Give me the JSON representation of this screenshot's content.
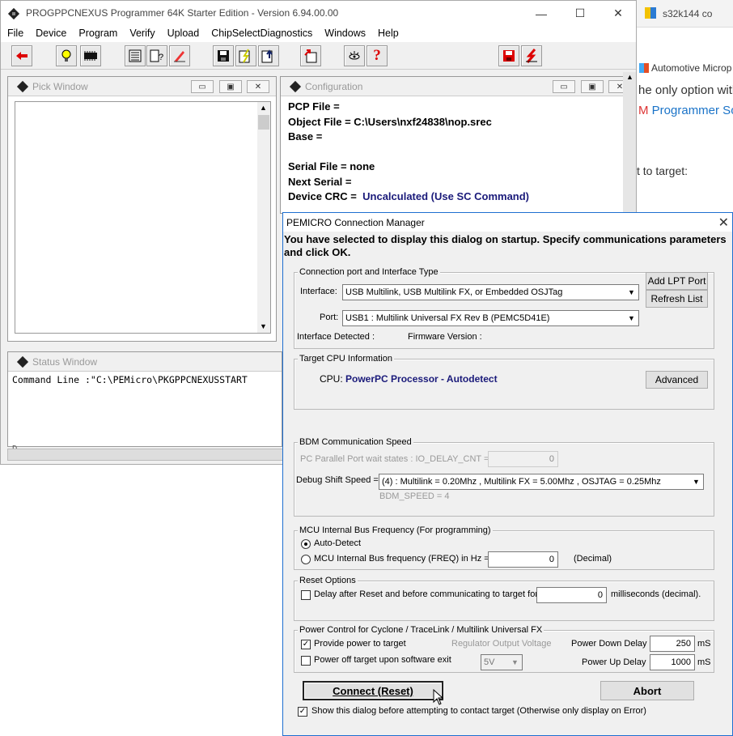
{
  "browser": {
    "tab_title": "s32k144 co",
    "bookmark": "Automotive Microp",
    "line1": "he only option with",
    "line2_red": "M",
    "line2": " Programmer Sof",
    "line3": "t to target:"
  },
  "window": {
    "title": "PROGPPCNEXUS Programmer 64K Starter Edition - Version 6.94.00.00",
    "controls": {
      "minimize": "—",
      "maximize": "☐",
      "close": "✕"
    }
  },
  "menu": [
    "File",
    "Device",
    "Program",
    "Verify",
    "Upload",
    "ChipSelectDiagnostics",
    "Windows",
    "Help"
  ],
  "toolbar_icons": [
    "back-arrow-icon",
    "lightbulb-icon",
    "chip-icon",
    "list-icon",
    "question-doc-icon",
    "pencil-icon",
    "save-icon",
    "lightning-doc-icon",
    "upload-doc-icon",
    "export-icon",
    "eye-icon",
    "help-icon",
    "red-save-icon",
    "red-lightning-icon"
  ],
  "pick_window": {
    "title": "Pick Window"
  },
  "status_window": {
    "title": "Status Window",
    "text": "Command Line :\"C:\\PEMicro\\PKGPPCNEXUSSTART",
    "text2": "D"
  },
  "configuration": {
    "title": "Configuration",
    "lines": [
      {
        "label": "PCP File =",
        "value": ""
      },
      {
        "label": "Object File = C:\\Users\\nxf24838\\nop.srec",
        "value": ""
      },
      {
        "label": "Base =",
        "value": ""
      },
      {
        "label": "",
        "value": ""
      },
      {
        "label": "Serial File = none",
        "value": ""
      },
      {
        "label": "Next Serial  =",
        "value": ""
      },
      {
        "label": "Device CRC =",
        "value": "Uncalculated (Use SC Command)"
      }
    ]
  },
  "dialog": {
    "title": "PEMICRO Connection Manager",
    "close": "✕",
    "intro": "You have selected to display this dialog on startup. Specify communications parameters and click OK.",
    "conn": {
      "legend": "Connection port and Interface Type",
      "interface_label": "Interface:",
      "interface_value": "USB Multilink, USB Multilink FX, or Embedded OSJTag",
      "port_label": "Port:",
      "port_value": "USB1 : Multilink Universal FX Rev B (PEMC5D41E)",
      "detected": "Interface Detected :",
      "firmware": "Firmware Version :",
      "add_lpt": "Add LPT Port",
      "refresh": "Refresh List"
    },
    "cpu": {
      "legend": "Target CPU Information",
      "label": "CPU:",
      "value": "PowerPC Processor - Autodetect",
      "advanced": "Advanced"
    },
    "bdm": {
      "legend": "BDM Communication Speed",
      "io_label": "PC Parallel Port wait states : IO_DELAY_CNT =",
      "io_value": "0",
      "shift_label": "Debug Shift Speed =",
      "shift_value": "(4)  :  Multilink = 0.20Mhz  ,  Multilink FX =  5.00Mhz  ,  OSJTAG = 0.25Mhz",
      "bdm_speed": "BDM_SPEED = 4"
    },
    "mcu": {
      "legend": "MCU Internal Bus Frequency (For programming)",
      "auto": "Auto-Detect",
      "freq": "MCU Internal Bus frequency (FREQ) in Hz =",
      "freq_value": "0",
      "decimal": "(Decimal)"
    },
    "reset": {
      "legend": "Reset Options",
      "delay": "Delay after Reset and before communicating to target for",
      "delay_value": "0",
      "ms": "milliseconds (decimal)."
    },
    "power": {
      "legend": "Power Control for Cyclone / TraceLink / Multilink Universal FX",
      "provide": "Provide power to target",
      "regulator": "Regulator Output Voltage",
      "off": "Power off target upon software exit",
      "voltage": "5V",
      "down_label": "Power Down Delay",
      "down_value": "250",
      "up_label": "Power Up Delay",
      "up_value": "1000",
      "ms": "mS"
    },
    "connect": "Connect (Reset)",
    "abort": "Abort",
    "show_dialog": "Show this dialog before attempting to contact target (Otherwise only display on Error)"
  }
}
